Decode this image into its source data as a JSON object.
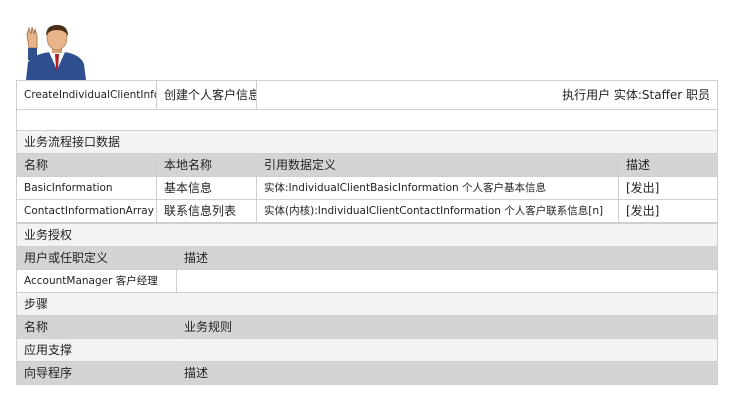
{
  "header": {
    "operation_id": "CreateIndividualClientInformation",
    "operation_name": "创建个人客户信息",
    "executor": "执行用户 实体:Staffer 职员"
  },
  "interface_section": {
    "title": "业务流程接口数据",
    "columns": [
      "名称",
      "本地名称",
      "引用数据定义",
      "描述"
    ],
    "rows": [
      {
        "name": "BasicInformation",
        "local": "基本信息",
        "ref": "实体:IndividualClientBasicInformation 个人客户基本信息",
        "desc": "[发出]"
      },
      {
        "name": "ContactInformationArray",
        "local": "联系信息列表",
        "ref": "实体(内核):IndividualClientContactInformation 个人客户联系信息[n]",
        "desc": "[发出]"
      }
    ]
  },
  "auth_section": {
    "title": "业务授权",
    "columns": [
      "用户或任职定义",
      "描述"
    ],
    "rows": [
      {
        "role": "AccountManager 客户经理",
        "desc": ""
      }
    ]
  },
  "steps_section": {
    "title": "步骤",
    "columns": [
      "名称",
      "业务规则"
    ]
  },
  "support_section": {
    "title": "应用支撑",
    "columns": [
      "向导程序",
      "描述"
    ]
  }
}
